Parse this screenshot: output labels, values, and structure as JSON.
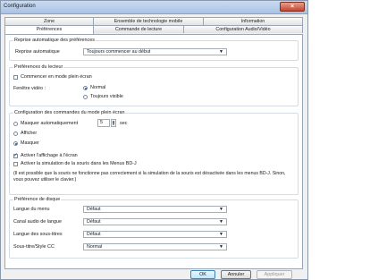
{
  "window": {
    "title": "Configuration",
    "close_glyph": "×"
  },
  "tabs": {
    "row1": [
      "Zone",
      "Ensemble de technologie mobile",
      "Information"
    ],
    "row2": [
      "Préférences",
      "Commande de lecture",
      "Configuration Audio/Vidéo"
    ],
    "active": "Préférences"
  },
  "auto_resume": {
    "group_title": "Reprise automatique des préférences",
    "label": "Reprise automatique",
    "value": "Toujours commencer au début"
  },
  "player": {
    "group_title": "Préférences du lecteur",
    "fullscreen_label": "Commencer en mode plein écran",
    "fullscreen_checked": false,
    "video_window_label": "Fenêtre vidéo :",
    "radio_normal": "Normal",
    "radio_always_visible": "Toujours visible",
    "selected": "Normal"
  },
  "fullscreen_controls": {
    "group_title": "Configuration des commandes du mode plein écran",
    "auto_hide": "Masquer automatiquement",
    "show": "Afficher",
    "hide": "Masquer",
    "selected": "Masquer",
    "seconds_value": "5",
    "seconds_unit": "sec",
    "osd_label": "Activer l'affichage à l'écran",
    "osd_checked": true,
    "mouse_sim_label": "Activer la simulation de la souris dans les Menus BD-J",
    "mouse_sim_checked": false,
    "note": "(Il est possible que la souris ne fonctionne pas correctement si la simulation de la souris est désactivée dans les menus BD-J. Sinon, vous pouvez utiliser le clavier.)"
  },
  "disc": {
    "group_title": "Préférence de disque",
    "rows": [
      {
        "label": "Langue du menu",
        "value": "Défaut"
      },
      {
        "label": "Canal audio de langue",
        "value": "Défaut"
      },
      {
        "label": "Langue des sous-titres",
        "value": "Défaut"
      },
      {
        "label": "Sous-titre/Style CC",
        "value": "Normal"
      }
    ]
  },
  "buttons": {
    "ok": "OK",
    "cancel": "Annuler",
    "apply": "Appliquer"
  },
  "icons": {
    "dropdown": "▼",
    "spin_up": "▲",
    "spin_down": "▼"
  }
}
